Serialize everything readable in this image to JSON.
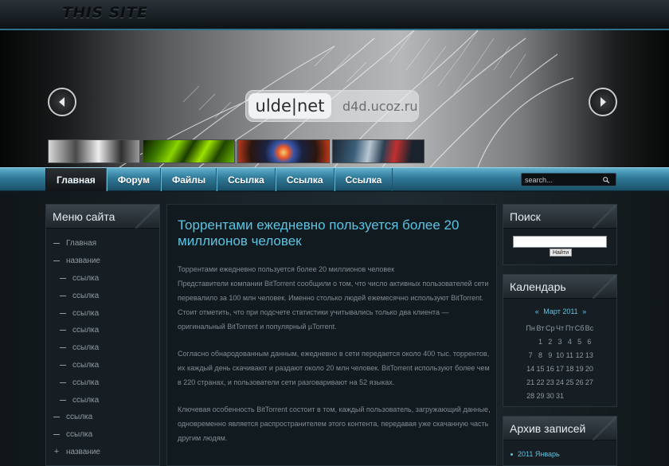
{
  "header": {
    "site_title": "THIS SITE"
  },
  "banner": {
    "logo_main": "ulde|net",
    "logo_url": "d4d.ucoz.ru",
    "prev_icon": "arrow-left-icon",
    "next_icon": "arrow-right-icon"
  },
  "nav": {
    "items": [
      {
        "label": "Главная",
        "active": true
      },
      {
        "label": "Форум"
      },
      {
        "label": "Файлы"
      },
      {
        "label": "Ссылка"
      },
      {
        "label": "Ссылка"
      },
      {
        "label": "Ссылка"
      }
    ],
    "search_placeholder": "search..."
  },
  "left_menu": {
    "title": "Меню сайта",
    "items": [
      {
        "label": "Главная",
        "level": 1
      },
      {
        "label": "название",
        "level": 1
      },
      {
        "label": "ссылка",
        "level": 2
      },
      {
        "label": "ссылка",
        "level": 2
      },
      {
        "label": "ссылка",
        "level": 2
      },
      {
        "label": "ссылка",
        "level": 2
      },
      {
        "label": "ссылка",
        "level": 2
      },
      {
        "label": "ссылка",
        "level": 2
      },
      {
        "label": "ссылка",
        "level": 2
      },
      {
        "label": "ссылка",
        "level": 2
      },
      {
        "label": "ссылка",
        "level": 1
      },
      {
        "label": "ссылка",
        "level": 1
      },
      {
        "label": "название",
        "level": 1,
        "marker": "+"
      }
    ]
  },
  "article": {
    "title": "Торрентами ежедневно пользуется более 20 миллионов человек",
    "paragraphs": [
      "Торрентами ежедневно пользуется более 20 миллионов человек\nПредставители компании BitTorrent сообщили о том, что число активных пользователей сети перевалило за 100 млн человек. Именно столько людей ежемесячно используют BitTorrent. Стоит отметить, что при подсчете статистики учитывались только два клиента — оригинальный BitTorrent и популярный µTorrent.",
      "Согласно обнародованным данным, ежедневно в сети передается около 400 тыс. торрентов, их каждый день скачивают и раздают около 20 млн человек. BitTorrent используют более чем в 220 странах, и пользователи сети разговаривают на 52 языках.",
      "Ключевая особенность BitTorrent состоит в том, каждый пользователь, загружающий данные, одновременно является распространителем этого контента, передавая уже скачанную часть другим людям."
    ]
  },
  "search_panel": {
    "title": "Поиск",
    "button_label": "Найти"
  },
  "calendar": {
    "title": "Календарь",
    "prev": "«",
    "next": "»",
    "month": "Март 2011",
    "weekdays": [
      "Пн",
      "Вт",
      "Ср",
      "Чт",
      "Пт",
      "Сб",
      "Вс"
    ],
    "days": [
      "",
      "1",
      "2",
      "3",
      "4",
      "5",
      "6",
      "7",
      "8",
      "9",
      "10",
      "11",
      "12",
      "13",
      "14",
      "15",
      "16",
      "17",
      "18",
      "19",
      "20",
      "21",
      "22",
      "23",
      "24",
      "25",
      "26",
      "27",
      "28",
      "29",
      "30",
      "31",
      "",
      "",
      ""
    ]
  },
  "archive": {
    "title": "Архив записей",
    "items": [
      "2011 Январь"
    ]
  },
  "colors": {
    "accent": "#5cc3e2",
    "nav": "#2f7897",
    "background": "#121a20"
  }
}
